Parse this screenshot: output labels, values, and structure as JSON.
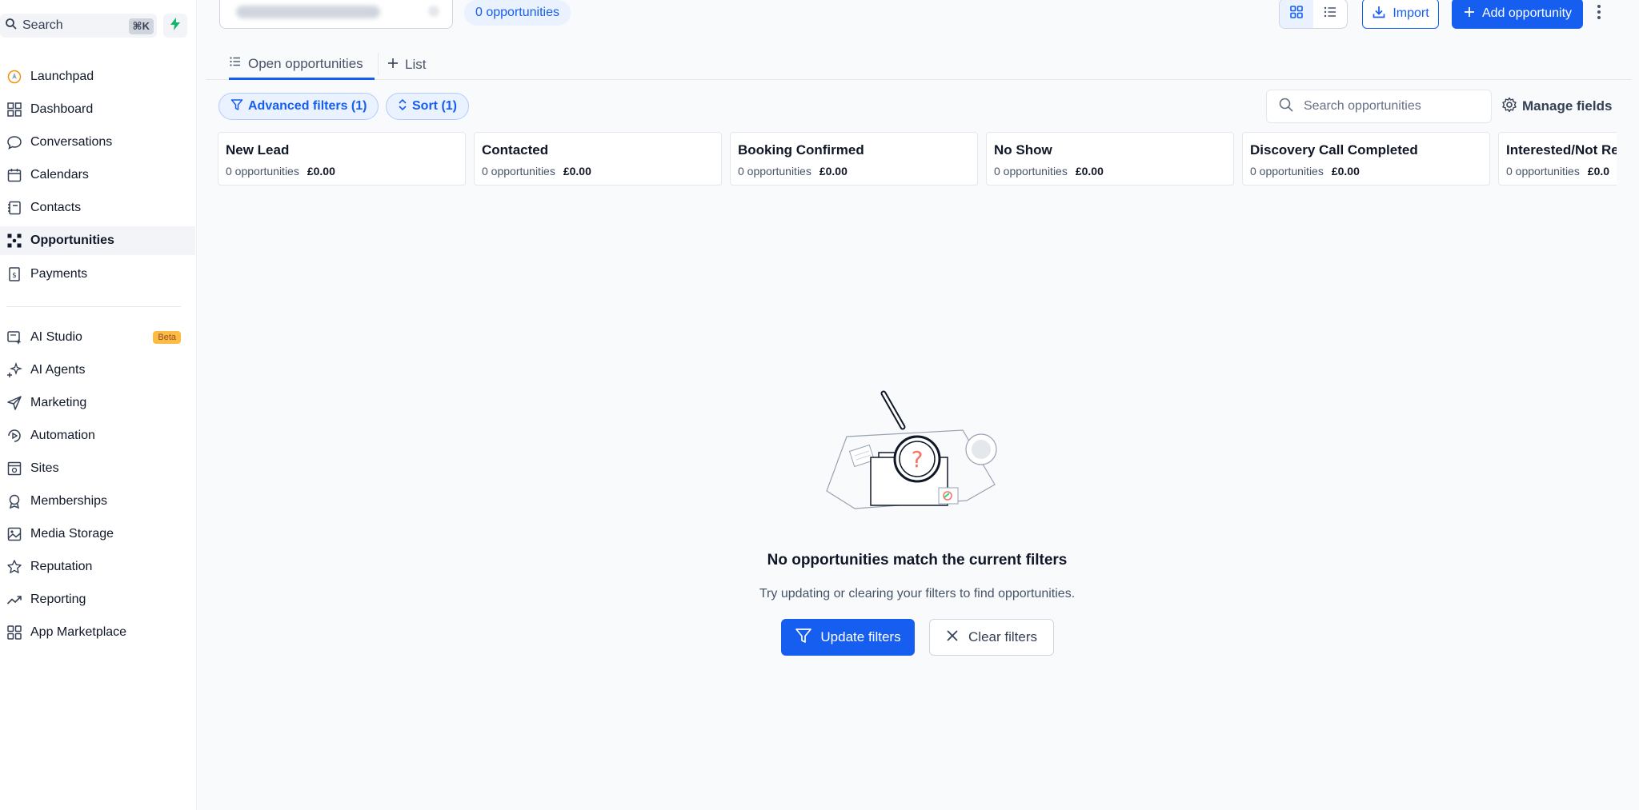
{
  "sidebar": {
    "search": {
      "label": "Search",
      "shortcut": "⌘K"
    },
    "items": [
      {
        "label": "Launchpad",
        "icon": "launchpad-icon"
      },
      {
        "label": "Dashboard",
        "icon": "dashboard-icon"
      },
      {
        "label": "Conversations",
        "icon": "chat-icon"
      },
      {
        "label": "Calendars",
        "icon": "calendar-icon"
      },
      {
        "label": "Contacts",
        "icon": "contacts-icon"
      },
      {
        "label": "Opportunities",
        "icon": "opportunities-icon",
        "active": true
      },
      {
        "label": "Payments",
        "icon": "payments-icon"
      },
      {
        "label": "AI Studio",
        "icon": "ai-studio-icon",
        "badge": "Beta"
      },
      {
        "label": "AI Agents",
        "icon": "sparkle-icon"
      },
      {
        "label": "Marketing",
        "icon": "send-icon"
      },
      {
        "label": "Automation",
        "icon": "automation-icon"
      },
      {
        "label": "Sites",
        "icon": "sites-icon"
      },
      {
        "label": "Memberships",
        "icon": "membership-icon"
      },
      {
        "label": "Media Storage",
        "icon": "image-icon"
      },
      {
        "label": "Reputation",
        "icon": "star-icon"
      },
      {
        "label": "Reporting",
        "icon": "trend-icon"
      },
      {
        "label": "App Marketplace",
        "icon": "apps-icon"
      }
    ]
  },
  "header": {
    "opportunity_count": "0 opportunities",
    "import_label": "Import",
    "add_label": "Add opportunity"
  },
  "tabs": [
    {
      "label": "Open opportunities",
      "active": true
    },
    {
      "label": "List",
      "active": false
    }
  ],
  "filters": {
    "advanced_label": "Advanced filters (1)",
    "sort_label": "Sort (1)",
    "search_placeholder": "Search opportunities",
    "manage_fields_label": "Manage fields"
  },
  "stages": [
    {
      "name": "New Lead",
      "count": "0 opportunities",
      "value": "£0.00"
    },
    {
      "name": "Contacted",
      "count": "0 opportunities",
      "value": "£0.00"
    },
    {
      "name": "Booking Confirmed",
      "count": "0 opportunities",
      "value": "£0.00"
    },
    {
      "name": "No Show",
      "count": "0 opportunities",
      "value": "£0.00"
    },
    {
      "name": "Discovery Call Completed",
      "count": "0 opportunities",
      "value": "£0.00"
    },
    {
      "name": "Interested/Not Re",
      "count": "0 opportunities",
      "value": "£0.0"
    }
  ],
  "empty_state": {
    "title": "No opportunities match the current filters",
    "subtitle": "Try updating or clearing your filters to find opportunities.",
    "update_label": "Update filters",
    "clear_label": "Clear filters"
  },
  "colors": {
    "primary": "#155eef",
    "primary_light": "#eaf1ff",
    "beta_badge": "#fdb022",
    "bolt": "#12b76a"
  }
}
